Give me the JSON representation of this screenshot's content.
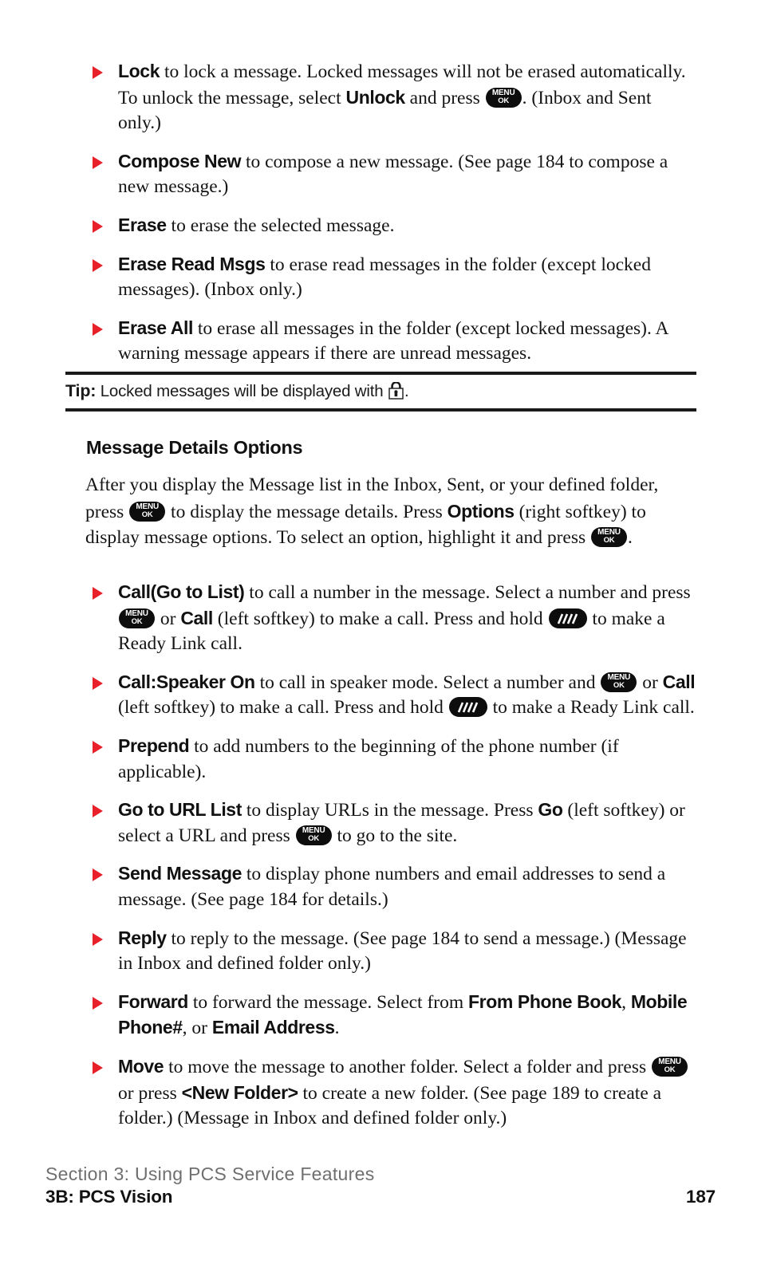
{
  "page": {
    "number": "187",
    "section_line": "Section 3: Using PCS Service Features",
    "chapter_line": "3B: PCS Vision"
  },
  "colors": {
    "bullet_red": "#e8202a",
    "text_black": "#141414",
    "footer_gray": "#6f6f6f",
    "rule_black": "#1a1a1a",
    "key_black": "#0d0d0d"
  },
  "icons": {
    "menu_ok_line1": "MENU",
    "menu_ok_line2": "OK",
    "ready_link": "ready-link-key",
    "lock": "lock-icon",
    "bullet": "red-triangle-bullet"
  },
  "folder_options": {
    "items": [
      {
        "term": "Lock",
        "parts": [
          {
            "t": "text",
            "v": " to lock a message. Locked messages will not be erased automatically. To unlock the message, select "
          },
          {
            "t": "bold",
            "v": "Unlock"
          },
          {
            "t": "text",
            "v": " and press "
          },
          {
            "t": "key",
            "v": "menu-ok"
          },
          {
            "t": "text",
            "v": ". (Inbox and Sent only.)"
          }
        ]
      },
      {
        "term": "Compose New",
        "parts": [
          {
            "t": "text",
            "v": " to compose a new message. (See page 184 to compose a new message.)"
          }
        ]
      },
      {
        "term": "Erase",
        "parts": [
          {
            "t": "text",
            "v": " to erase the selected message."
          }
        ]
      },
      {
        "term": "Erase Read Msgs",
        "parts": [
          {
            "t": "text",
            "v": " to erase read messages in the folder (except locked messages). (Inbox only.)"
          }
        ]
      },
      {
        "term": "Erase All",
        "parts": [
          {
            "t": "text",
            "v": " to erase all messages in the folder (except locked messages). A warning message appears if there are unread messages."
          }
        ]
      }
    ]
  },
  "tip": {
    "label": "Tip:",
    "text_before": " Locked messages will be displayed with ",
    "text_after": "."
  },
  "message_details": {
    "heading": "Message Details Options",
    "paragraph_parts": [
      {
        "t": "text",
        "v": "After you display the Message list in the Inbox, Sent, or your defined folder, press "
      },
      {
        "t": "key",
        "v": "menu-ok"
      },
      {
        "t": "text",
        "v": " to display the message details. Press "
      },
      {
        "t": "bold",
        "v": "Options"
      },
      {
        "t": "text",
        "v": " (right softkey) to display message options. To select an option, highlight it and press "
      },
      {
        "t": "key",
        "v": "menu-ok"
      },
      {
        "t": "text",
        "v": "."
      }
    ],
    "items": [
      {
        "term": "Call(Go to List)",
        "parts": [
          {
            "t": "text",
            "v": " to call a number in the message. Select a number and press "
          },
          {
            "t": "key",
            "v": "menu-ok"
          },
          {
            "t": "text",
            "v": " or "
          },
          {
            "t": "bold",
            "v": "Call"
          },
          {
            "t": "text",
            "v": " (left softkey) to make a call. Press and hold "
          },
          {
            "t": "key",
            "v": "ready-link"
          },
          {
            "t": "text",
            "v": " to make a Ready Link call."
          }
        ]
      },
      {
        "term": "Call:Speaker On",
        "parts": [
          {
            "t": "text",
            "v": " to call in speaker mode. Select a number and "
          },
          {
            "t": "key",
            "v": "menu-ok"
          },
          {
            "t": "text",
            "v": " or "
          },
          {
            "t": "bold",
            "v": "Call"
          },
          {
            "t": "text",
            "v": " (left softkey) to make a call. Press and hold "
          },
          {
            "t": "key",
            "v": "ready-link"
          },
          {
            "t": "text",
            "v": " to make a Ready Link call."
          }
        ]
      },
      {
        "term": "Prepend",
        "parts": [
          {
            "t": "text",
            "v": " to add numbers to the beginning of the phone number (if applicable)."
          }
        ]
      },
      {
        "term": "Go to URL List",
        "parts": [
          {
            "t": "text",
            "v": " to display URLs in the message. Press "
          },
          {
            "t": "bold",
            "v": "Go"
          },
          {
            "t": "text",
            "v": " (left softkey) or select a URL and press "
          },
          {
            "t": "key",
            "v": "menu-ok"
          },
          {
            "t": "text",
            "v": " to go to the site."
          }
        ]
      },
      {
        "term": "Send Message",
        "parts": [
          {
            "t": "text",
            "v": " to display phone numbers and email addresses to send a message. (See page 184 for details.)"
          }
        ]
      },
      {
        "term": "Reply",
        "parts": [
          {
            "t": "text",
            "v": " to reply to the message. (See page 184 to send a message.) (Message in Inbox and defined folder only.)"
          }
        ]
      },
      {
        "term": "Forward",
        "parts": [
          {
            "t": "text",
            "v": " to forward the message. Select from "
          },
          {
            "t": "bold",
            "v": "From Phone Book"
          },
          {
            "t": "text",
            "v": ", "
          },
          {
            "t": "bold",
            "v": "Mobile Phone#"
          },
          {
            "t": "text",
            "v": ", or "
          },
          {
            "t": "bold",
            "v": "Email Address"
          },
          {
            "t": "text",
            "v": "."
          }
        ]
      },
      {
        "term": "Move",
        "parts": [
          {
            "t": "text",
            "v": " to move the message to another folder. Select a folder and press "
          },
          {
            "t": "key",
            "v": "menu-ok"
          },
          {
            "t": "text",
            "v": " or press "
          },
          {
            "t": "bold",
            "v": "<New Folder>"
          },
          {
            "t": "text",
            "v": " to create a new folder. (See page 189 to create a folder.) (Message in Inbox and defined folder only.)"
          }
        ]
      }
    ]
  }
}
